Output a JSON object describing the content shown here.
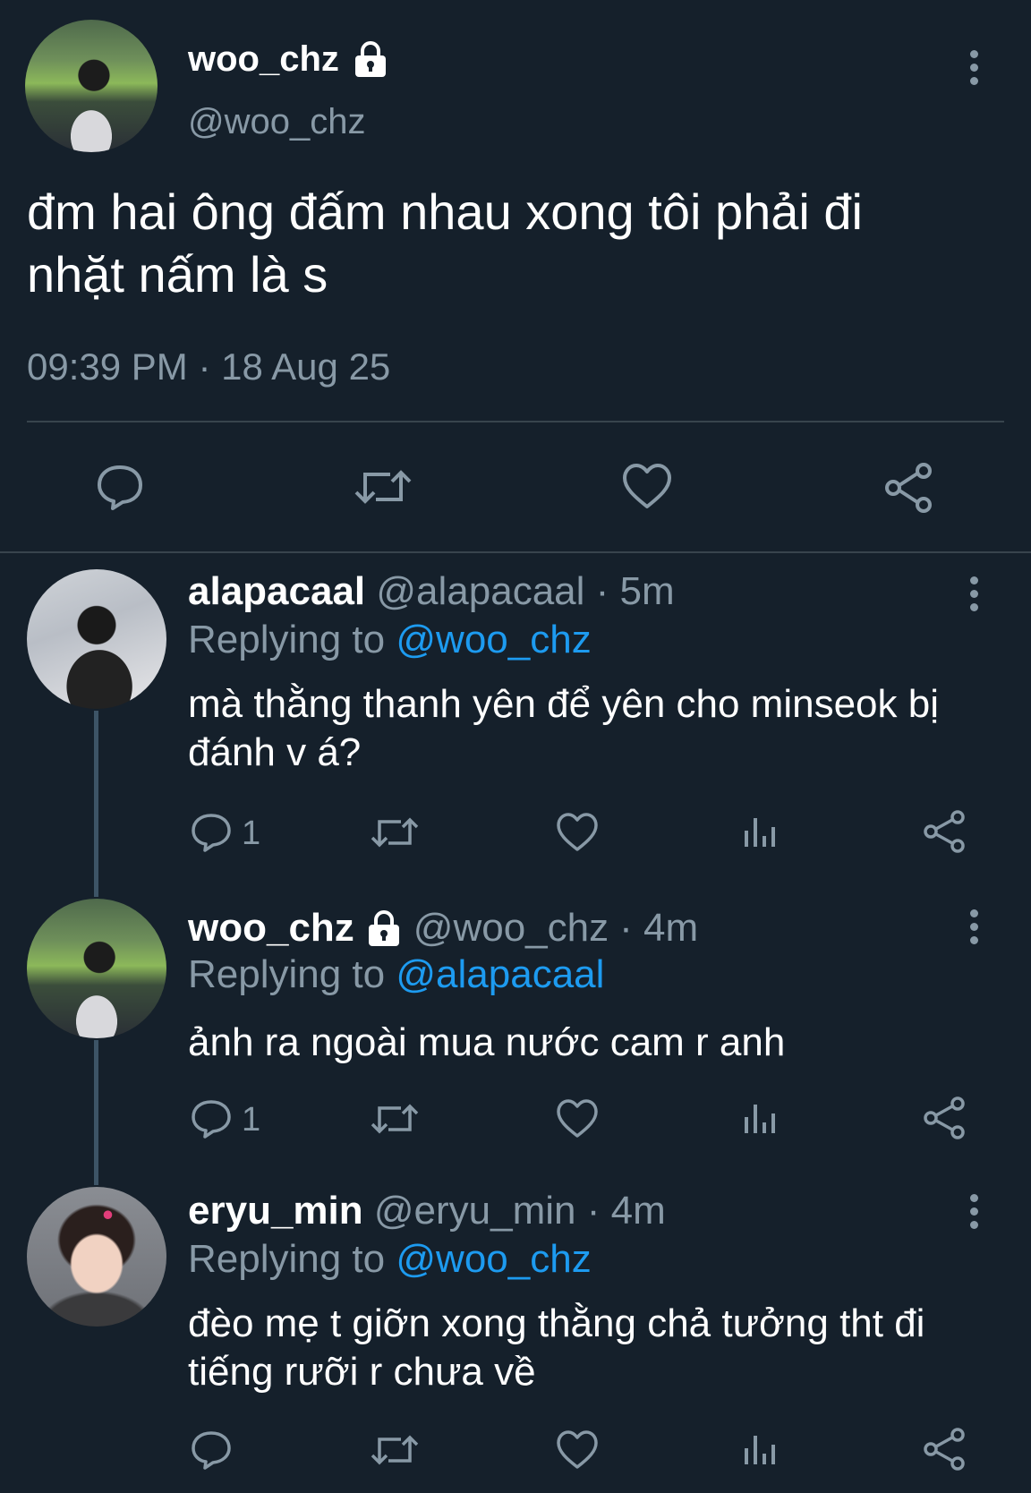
{
  "main_tweet": {
    "display_name": "woo_chz",
    "handle": "@woo_chz",
    "text_line1": "đm hai ông đấm nhau xong tôi phải đi",
    "text_line2": "nhặt nấm là s",
    "timestamp": "09:39 PM · 18 Aug 25",
    "icons": [
      "reply-icon",
      "retweet-icon",
      "like-icon",
      "share-icon"
    ]
  },
  "replies": [
    {
      "display_name": "alapacaal",
      "handle": "@alapacaal",
      "time": "· 5m",
      "replying_prefix": "Replying to",
      "replying_to": "@woo_chz",
      "text_line1": "mà thằng thanh yên để yên cho minseok bị",
      "text_line2": "đánh v á?",
      "reply_count": "1"
    },
    {
      "display_name": "woo_chz",
      "handle": "@woo_chz",
      "time": "· 4m",
      "replying_prefix": "Replying to",
      "replying_to": "@alapacaal",
      "text_line1": "ảnh ra ngoài mua nước cam r anh",
      "reply_count": "1"
    },
    {
      "display_name": "eryu_min",
      "handle": "@eryu_min",
      "time": "· 4m",
      "replying_prefix": "Replying to",
      "replying_to": "@woo_chz",
      "text_line1": "đèo mẹ t giỡn xong thằng chả tưởng tht đi",
      "text_line2": "tiếng rưỡi r chưa về"
    }
  ],
  "colors": {
    "background": "#15202b",
    "muted": "#8899a6",
    "link": "#1d9bf0",
    "divider": "#38444d"
  }
}
